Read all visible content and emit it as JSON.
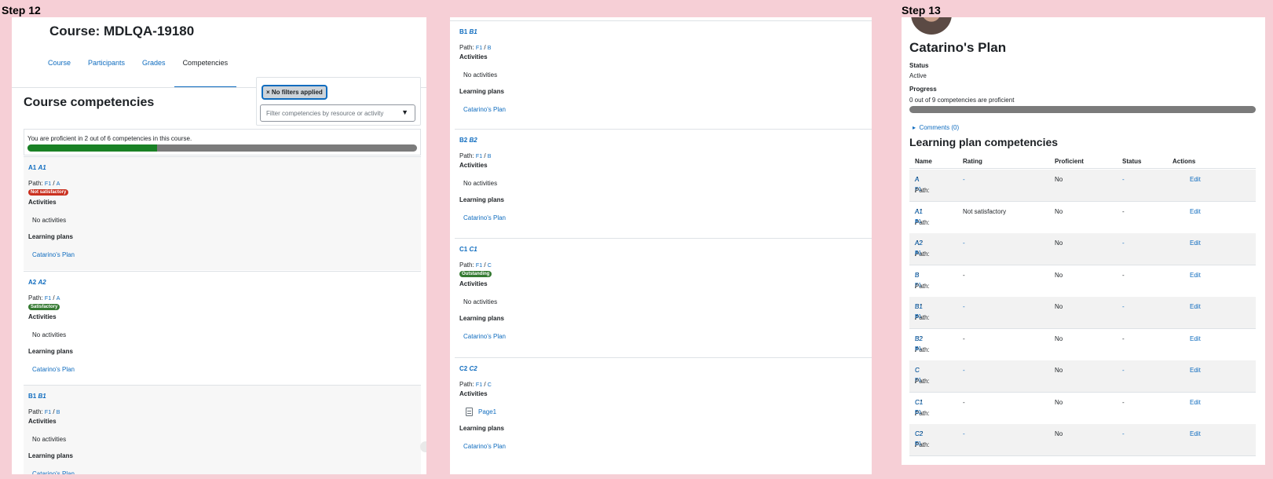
{
  "steps": {
    "left": "Step 12",
    "right": "Step 13"
  },
  "course": {
    "title": "Course: MDLQA-19180",
    "tabs": [
      "Course",
      "Participants",
      "Grades",
      "Competencies"
    ],
    "active_tab": "Competencies",
    "section_title": "Course competencies",
    "filter": {
      "tag": "× No filters applied",
      "placeholder": "Filter competencies by resource or activity",
      "caret": "▼"
    },
    "proficiency": {
      "text": "You are proficient in 2 out of 6 competencies in this course.",
      "proficient": 2,
      "total": 6
    },
    "labels": {
      "path": "Path:",
      "activities": "Activities",
      "no_activities": "No activities",
      "learning_plans": "Learning plans",
      "plan_name": "Catarino's Plan",
      "sep": "/"
    }
  },
  "competencies_left": [
    {
      "id": "A1",
      "name": "A1",
      "path": [
        "F1",
        "A"
      ],
      "rating": "Not satisfactory",
      "rating_color": "#ca3120"
    },
    {
      "id": "A2",
      "name": "A2",
      "path": [
        "F1",
        "A"
      ],
      "rating": "Satisfactory",
      "rating_color": "#357a32"
    },
    {
      "id": "B1",
      "name": "B1",
      "path": [
        "F1",
        "B"
      ]
    }
  ],
  "competencies_middle": [
    {
      "id": "B1",
      "name": "B1",
      "path": [
        "F1",
        "B"
      ]
    },
    {
      "id": "B2",
      "name": "B2",
      "path": [
        "F1",
        "B"
      ]
    },
    {
      "id": "C1",
      "name": "C1",
      "path": [
        "F1",
        "C"
      ],
      "rating": "Outstanding",
      "rating_color": "#357a32"
    },
    {
      "id": "C2",
      "name": "C2",
      "path": [
        "F1",
        "C"
      ],
      "activity": "Page1"
    }
  ],
  "plan": {
    "title": "Catarino's Plan",
    "status_label": "Status",
    "status": "Active",
    "progress_label": "Progress",
    "progress_text": "0 out of 9 competencies are proficient",
    "proficient": 0,
    "total": 9,
    "comments": "Comments (0)",
    "section_title": "Learning plan competencies",
    "columns": [
      "Name",
      "Rating",
      "Proficient",
      "Status",
      "Actions"
    ],
    "rows": [
      {
        "id": "A",
        "name": "A",
        "path": [
          "F1",
          ""
        ],
        "rating": "-",
        "proficient": "No",
        "status": "-",
        "action": "Edit"
      },
      {
        "id": "A1",
        "name": "A1",
        "path": [
          "F1",
          "A"
        ],
        "rating": "Not satisfactory",
        "proficient": "No",
        "status": "-",
        "action": "Edit"
      },
      {
        "id": "A2",
        "name": "A2",
        "path": [
          "F1",
          "A"
        ],
        "rating": "-",
        "proficient": "No",
        "status": "-",
        "action": "Edit"
      },
      {
        "id": "B",
        "name": "B",
        "path": [
          "F1",
          ""
        ],
        "rating": "-",
        "proficient": "No",
        "status": "-",
        "action": "Edit"
      },
      {
        "id": "B1",
        "name": "B1",
        "path": [
          "F1",
          "B"
        ],
        "rating": "-",
        "proficient": "No",
        "status": "-",
        "action": "Edit"
      },
      {
        "id": "B2",
        "name": "B2",
        "path": [
          "F1",
          "B"
        ],
        "rating": "-",
        "proficient": "No",
        "status": "-",
        "action": "Edit"
      },
      {
        "id": "C",
        "name": "C",
        "path": [
          "F1",
          ""
        ],
        "rating": "-",
        "proficient": "No",
        "status": "-",
        "action": "Edit"
      },
      {
        "id": "C1",
        "name": "C1",
        "path": [
          "F1",
          "C"
        ],
        "rating": "-",
        "proficient": "No",
        "status": "-",
        "action": "Edit"
      },
      {
        "id": "C2",
        "name": "C2",
        "path": [
          "F1",
          "C"
        ],
        "rating": "-",
        "proficient": "No",
        "status": "-",
        "action": "Edit"
      }
    ]
  },
  "colors": {
    "link": "#0f6cbf",
    "progress_fill": "#198125",
    "progress_track": "#7b7b7b",
    "background": "#f6cfd6"
  }
}
